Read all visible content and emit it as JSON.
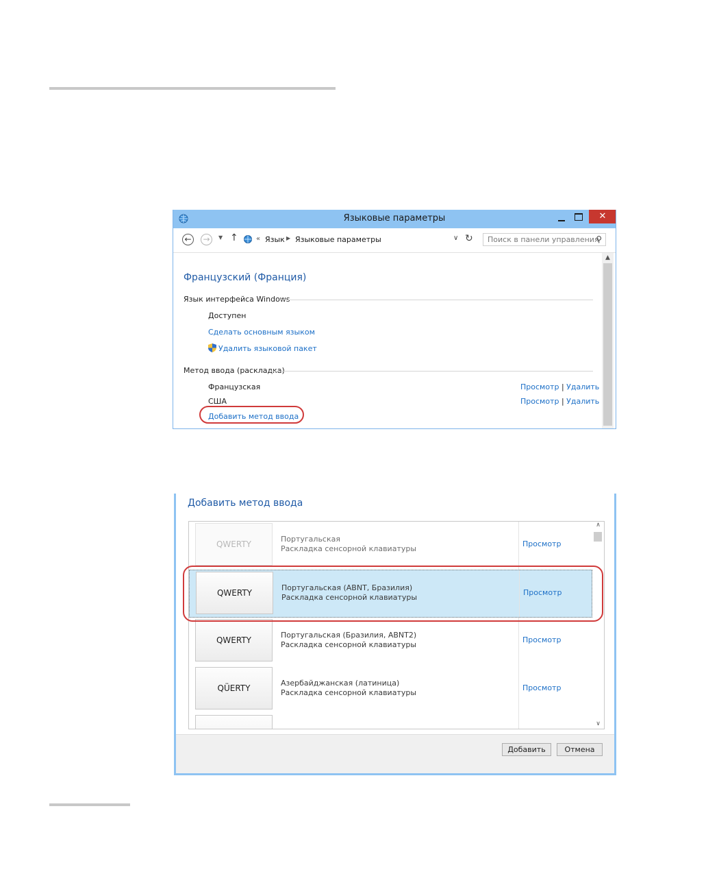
{
  "window1": {
    "title": "Языковые параметры",
    "close_glyph": "✕",
    "nav": {
      "back_glyph": "←",
      "forward_glyph": "→",
      "recent_glyph": "▼",
      "up_glyph": "↑"
    },
    "breadcrumb": {
      "more_glyph": "«",
      "items": [
        "Язык",
        "Языковые параметры"
      ],
      "separator_glyph": "▶",
      "dropdown_glyph": "∨",
      "refresh_glyph": "↻"
    },
    "search": {
      "placeholder": "Поиск в панели управления",
      "icon_glyph": "⚲"
    },
    "language_heading": "Французский (Франция)",
    "ui_language": {
      "section_label": "Язык интерфейса Windows",
      "status": "Доступен",
      "make_primary_link": "Сделать основным языком",
      "remove_pack_link": "Удалить языковой пакет"
    },
    "input_method": {
      "section_label": "Метод ввода (раскладка)",
      "rows": [
        {
          "name": "Французская",
          "preview": "Просмотр",
          "separator": "|",
          "remove": "Удалить"
        },
        {
          "name": "США",
          "preview": "Просмотр",
          "separator": "|",
          "remove": "Удалить"
        }
      ],
      "add_link": "Добавить метод ввода"
    },
    "scroll_up_glyph": "▲"
  },
  "window2": {
    "title": "Добавить метод ввода",
    "rows": [
      {
        "key_label": "QWERTY",
        "name": "Португальская",
        "subtitle": "Раскладка сенсорной клавиатуры",
        "preview": "Просмотр"
      },
      {
        "key_label": "QWERTY",
        "name": "Португальская (ABNT, Бразилия)",
        "subtitle": "Раскладка сенсорной клавиатуры",
        "preview": "Просмотр"
      },
      {
        "key_label": "QWERTY",
        "name": "Португальская (Бразилия, ABNT2)",
        "subtitle": "Раскладка сенсорной клавиатуры",
        "preview": "Просмотр"
      },
      {
        "key_label": "QÜERTY",
        "name": "Азербайджанская (латиница)",
        "subtitle": "Раскладка сенсорной клавиатуры",
        "preview": "Просмотр"
      }
    ],
    "scroll_up_glyph": "∧",
    "scroll_down_glyph": "∨",
    "buttons": {
      "add": "Добавить",
      "cancel": "Отмена"
    }
  },
  "colors": {
    "titlebar": "#8ec3f2",
    "link": "#1c6fc7",
    "heading": "#1f5aa6",
    "highlight_oval": "#d03a3a",
    "selected_row": "#cde8f7",
    "close_button": "#c7372f"
  }
}
